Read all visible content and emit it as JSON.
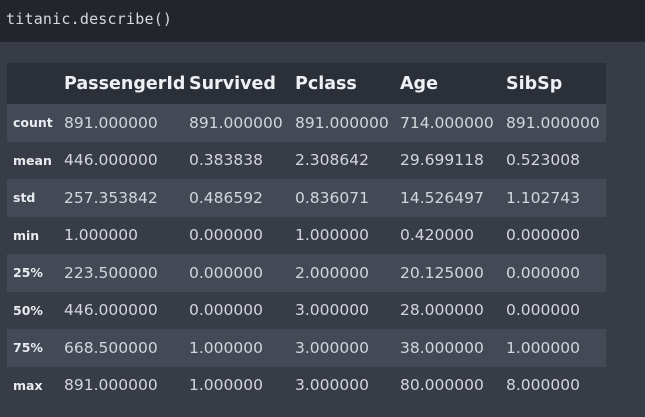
{
  "code_cell": {
    "source": "titanic.describe()"
  },
  "table": {
    "index_header": "",
    "columns": [
      "PassengerId",
      "Survived",
      "Pclass",
      "Age",
      "SibSp"
    ],
    "rows": [
      {
        "label": "count",
        "values": [
          "891.000000",
          "891.000000",
          "891.000000",
          "714.000000",
          "891.000000"
        ]
      },
      {
        "label": "mean",
        "values": [
          "446.000000",
          "0.383838",
          "2.308642",
          "29.699118",
          "0.523008"
        ]
      },
      {
        "label": "std",
        "values": [
          "257.353842",
          "0.486592",
          "0.836071",
          "14.526497",
          "1.102743"
        ]
      },
      {
        "label": "min",
        "values": [
          "1.000000",
          "0.000000",
          "1.000000",
          "0.420000",
          "0.000000"
        ]
      },
      {
        "label": "25%",
        "values": [
          "223.500000",
          "0.000000",
          "2.000000",
          "20.125000",
          "0.000000"
        ]
      },
      {
        "label": "50%",
        "values": [
          "446.000000",
          "0.000000",
          "3.000000",
          "28.000000",
          "0.000000"
        ]
      },
      {
        "label": "75%",
        "values": [
          "668.500000",
          "1.000000",
          "3.000000",
          "38.000000",
          "1.000000"
        ]
      },
      {
        "label": "max",
        "values": [
          "891.000000",
          "1.000000",
          "3.000000",
          "80.000000",
          "8.000000"
        ]
      }
    ]
  },
  "colors": {
    "code_background": "#22252c",
    "output_background": "#383c45",
    "header_row": "#2b2f37",
    "row_odd": "#434a56",
    "row_even": "#373c46"
  }
}
